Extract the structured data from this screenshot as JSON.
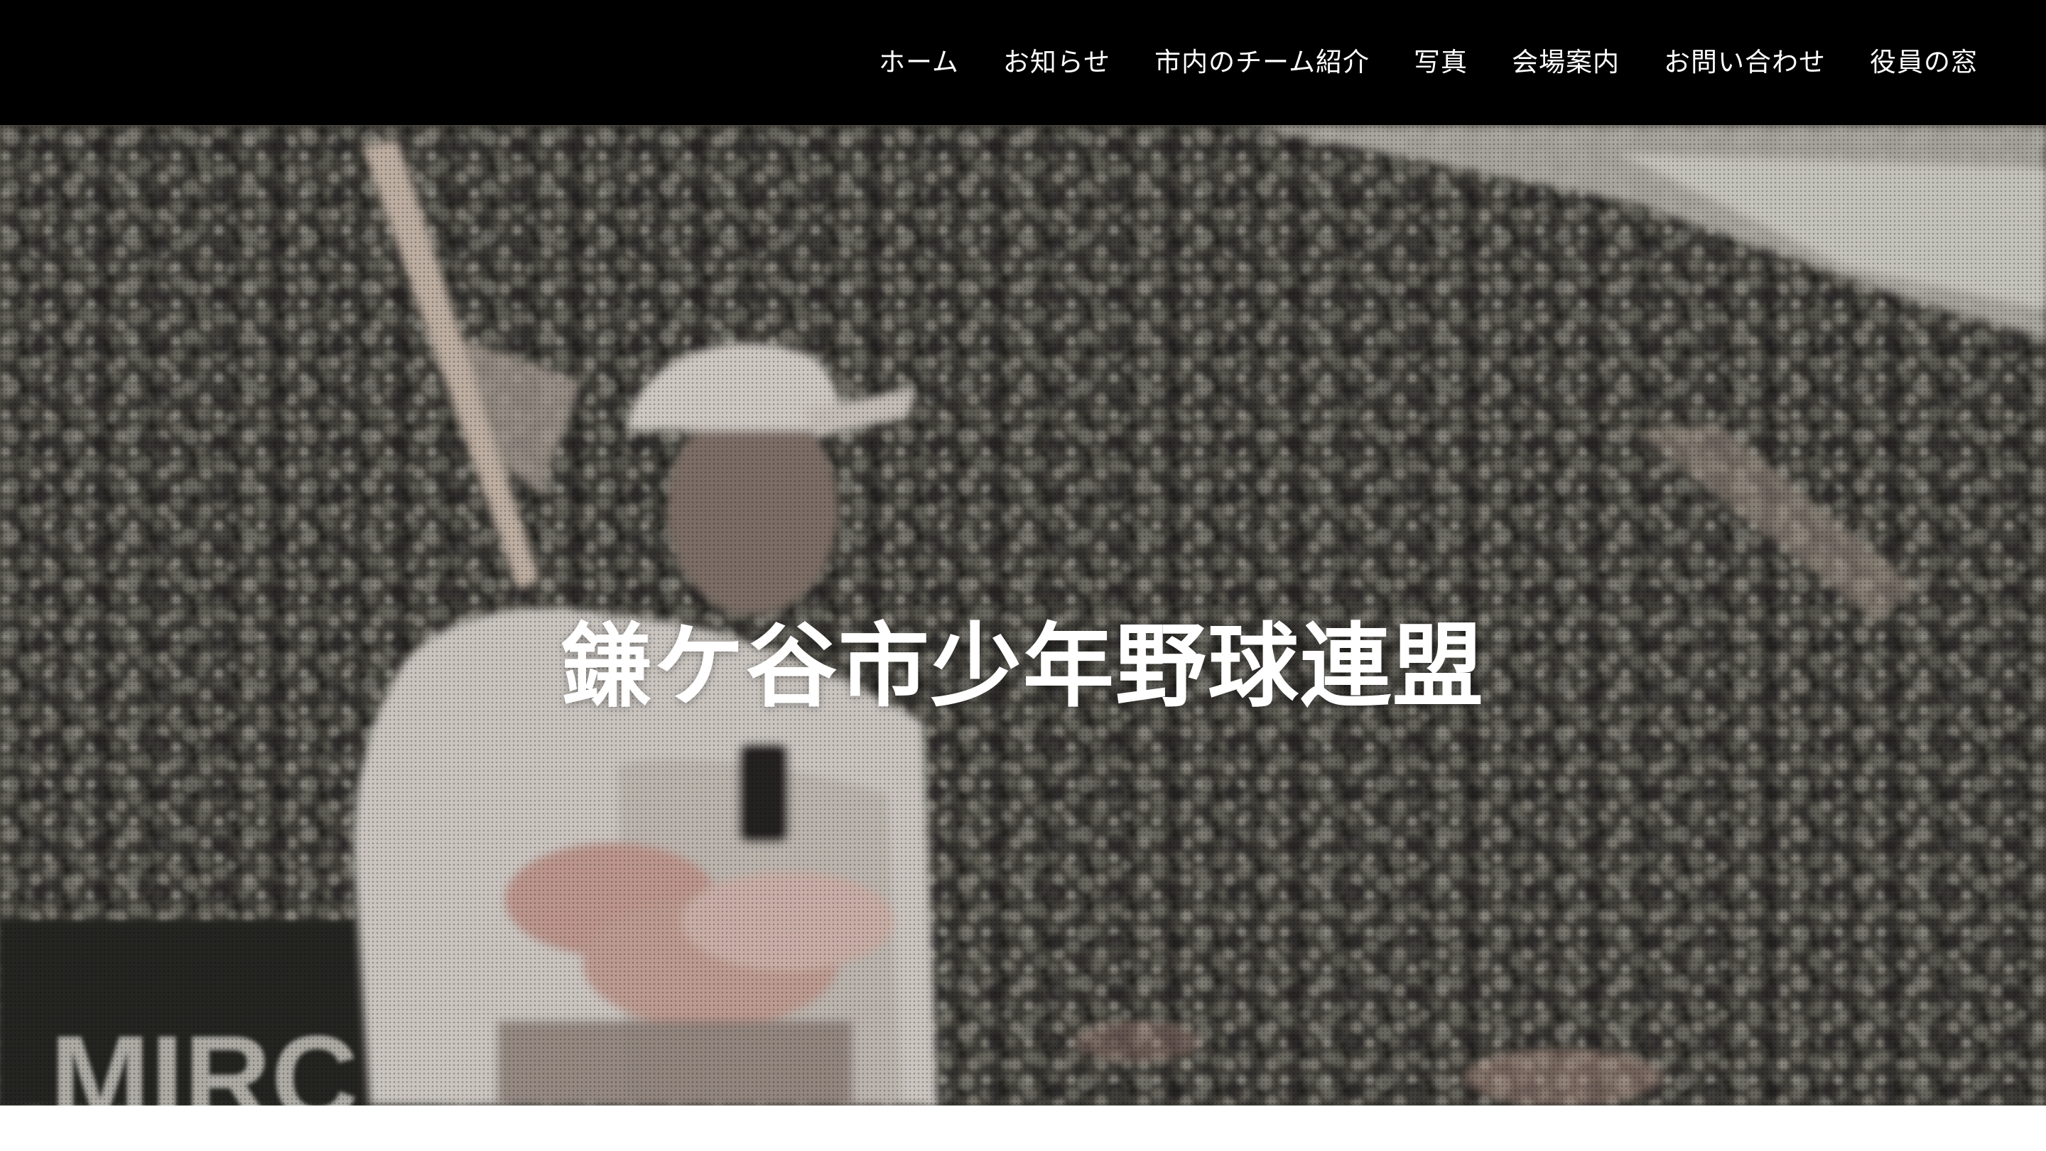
{
  "site": {
    "title": "鎌ケ谷市少年野球連盟"
  },
  "nav": {
    "items": [
      {
        "label": "ホーム"
      },
      {
        "label": "お知らせ"
      },
      {
        "label": "市内のチーム紹介"
      },
      {
        "label": "写真"
      },
      {
        "label": "会場案内"
      },
      {
        "label": "お問い合わせ"
      },
      {
        "label": "役員の窓"
      }
    ]
  },
  "hero": {
    "banner_text": "MIRC"
  },
  "colors": {
    "header_bg": "#000000",
    "nav_text": "#ffffff",
    "title_text": "#ffffff",
    "page_bg": "#ffffff"
  }
}
